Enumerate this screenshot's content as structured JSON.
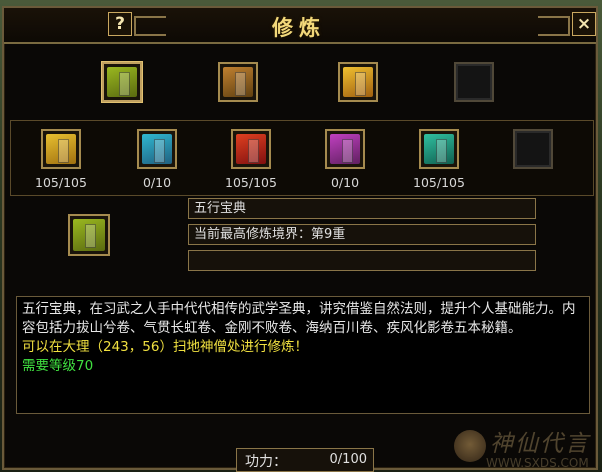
{
  "window": {
    "title": "修炼",
    "help_label": "?",
    "close_label": "×"
  },
  "top_slots": [
    {
      "name": "wuxing-baodian",
      "icon": "book-icon",
      "colors": [
        "#9ab820",
        "#5a6a10"
      ],
      "selected": true
    },
    {
      "name": "treasure-chest",
      "icon": "chest-icon",
      "colors": [
        "#c08030",
        "#604010"
      ],
      "selected": false
    },
    {
      "name": "gold-ingots",
      "icon": "gold-icon",
      "colors": [
        "#f0c030",
        "#a06010"
      ],
      "selected": false
    },
    {
      "name": "empty",
      "icon": "",
      "colors": [],
      "selected": false
    }
  ],
  "volumes": [
    {
      "icon": "yellow-book-icon",
      "colors": [
        "#e8c030",
        "#a07010"
      ],
      "progress": "105/105"
    },
    {
      "icon": "cyan-book-icon",
      "colors": [
        "#30b8d0",
        "#206080"
      ],
      "progress": "0/10"
    },
    {
      "icon": "red-book-icon",
      "colors": [
        "#e04020",
        "#801010"
      ],
      "progress": "105/105"
    },
    {
      "icon": "purple-book-icon",
      "colors": [
        "#c040c0",
        "#602060"
      ],
      "progress": "0/10"
    },
    {
      "icon": "teal-book-icon",
      "colors": [
        "#30c0a0",
        "#106050"
      ],
      "progress": "105/105"
    },
    {
      "icon": "",
      "colors": [],
      "progress": ""
    }
  ],
  "selected": {
    "icon": "book-icon",
    "name": "五行宝典",
    "realm": "当前最高修炼境界：第9重",
    "third": ""
  },
  "description": {
    "text": "五行宝典，在习武之人手中代代相传的武学圣典，讲究借鉴自然法则，提升个人基础能力。内容包括力拔山兮卷、气贯长虹卷、金刚不败卷、海纳百川卷、疾风化影卷五本秘籍。",
    "location": "可以在大理（243，56）扫地神僧处进行修炼！",
    "level": "需要等级70"
  },
  "gongli": {
    "label": "功力：",
    "value": "0/100"
  },
  "watermark": {
    "text": "神仙代言",
    "url": "WWW.SXDS.COM"
  }
}
